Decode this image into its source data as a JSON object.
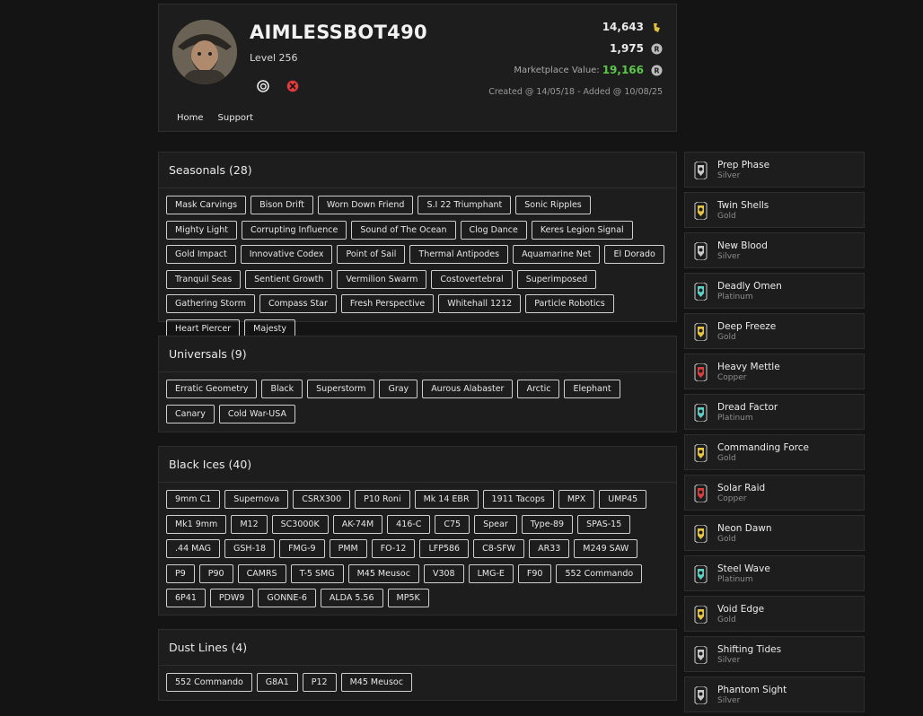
{
  "profile": {
    "username": "AIMLESSBOT490",
    "level": "Level 256",
    "stats": {
      "renown": "14,643",
      "credits": "1,975",
      "marketplace_label": "Marketplace Value:",
      "marketplace_value": "19,166"
    },
    "created": "Created @ 14/05/18 - Added @ 10/08/25",
    "nav": [
      "Home",
      "Support"
    ],
    "platforms": [
      "ubisoft-icon",
      "xbox-icon"
    ]
  },
  "colors": {
    "marketplace": "#5cc74a",
    "renown": "#e0c23a",
    "xbox": "#e23b3b"
  },
  "sections": [
    {
      "title": "Seasonals (28)",
      "items": [
        "Mask Carvings",
        "Bison Drift",
        "Worn Down Friend",
        "S.I 22 Triumphant",
        "Sonic Ripples",
        "Mighty Light",
        "Corrupting Influence",
        "Sound of The Ocean",
        "Clog Dance",
        "Keres Legion Signal",
        "Gold Impact",
        "Innovative Codex",
        "Point of Sail",
        "Thermal Antipodes",
        "Aquamarine Net",
        "El Dorado",
        "Tranquil Seas",
        "Sentient Growth",
        "Vermilion Swarm",
        "Costovertebral",
        "Superimposed",
        "Gathering Storm",
        "Compass Star",
        "Fresh Perspective",
        "Whitehall 1212",
        "Particle Robotics",
        "Heart Piercer",
        "Majesty"
      ]
    },
    {
      "title": "Universals (9)",
      "items": [
        "Erratic Geometry",
        "Black",
        "Superstorm",
        "Gray",
        "Aurous Alabaster",
        "Arctic",
        "Elephant",
        "Canary",
        "Cold War-USA"
      ]
    },
    {
      "title": "Black Ices (40)",
      "items": [
        "9mm C1",
        "Supernova",
        "CSRX300",
        "P10 Roni",
        "Mk 14 EBR",
        "1911 Tacops",
        "MPX",
        "UMP45",
        "Mk1 9mm",
        "M12",
        "SC3000K",
        "AK-74M",
        "416-C",
        "C75",
        "Spear",
        "Type-89",
        "SPAS-15",
        ".44 MAG",
        "GSH-18",
        "FMG-9",
        "PMM",
        "FO-12",
        "LFP586",
        "C8-SFW",
        "AR33",
        "M249 SAW",
        "P9",
        "P90",
        "CAMRS",
        "T-5 SMG",
        "M45 Meusoc",
        "V308",
        "LMG-E",
        "F90",
        "552 Commando",
        "6P41",
        "PDW9",
        "GONNE-6",
        "ALDA 5.56",
        "MP5K"
      ]
    },
    {
      "title": "Dust Lines (4)",
      "items": [
        "552 Commando",
        "G8A1",
        "P12",
        "M45 Meusoc"
      ]
    }
  ],
  "charms": [
    {
      "name": "Prep Phase",
      "tier": "Silver"
    },
    {
      "name": "Twin Shells",
      "tier": "Gold"
    },
    {
      "name": "New Blood",
      "tier": "Silver"
    },
    {
      "name": "Deadly Omen",
      "tier": "Platinum"
    },
    {
      "name": "Deep Freeze",
      "tier": "Gold"
    },
    {
      "name": "Heavy Mettle",
      "tier": "Copper"
    },
    {
      "name": "Dread Factor",
      "tier": "Platinum"
    },
    {
      "name": "Commanding Force",
      "tier": "Gold"
    },
    {
      "name": "Solar Raid",
      "tier": "Copper"
    },
    {
      "name": "Neon Dawn",
      "tier": "Gold"
    },
    {
      "name": "Steel Wave",
      "tier": "Platinum"
    },
    {
      "name": "Void Edge",
      "tier": "Gold"
    },
    {
      "name": "Shifting Tides",
      "tier": "Silver"
    },
    {
      "name": "Phantom Sight",
      "tier": "Silver"
    }
  ],
  "tier_colors": {
    "Silver": "#c9c9c9",
    "Gold": "#e5c542",
    "Platinum": "#5fd0c4",
    "Copper": "#d84040"
  }
}
